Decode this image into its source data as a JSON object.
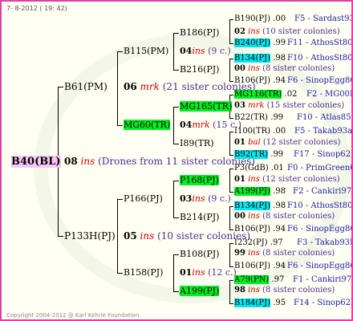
{
  "header": {
    "date": "7- 8-2012 ( 19: 42)"
  },
  "footer": {
    "copyright": "Copyright 2004-2012 @ Karl Kehrle Foundation."
  },
  "root": {
    "label": "B40(BL)",
    "num": "08",
    "mark": "ins",
    "note": "(Drones from 11 sister colonies)"
  },
  "gen1": [
    {
      "label": "B61(PM)",
      "num": "06",
      "mark": "mrk",
      "note": "(21 sister colonies)"
    },
    {
      "label": "P133H(PJ)",
      "num": "05",
      "mark": "ins",
      "note": "(10 sister colonies)"
    }
  ],
  "gen2": [
    {
      "label": "B115(PM)",
      "num": "04",
      "mark": "ins",
      "note": "(9 c.)"
    },
    {
      "label": "MG60(TR)",
      "num": "04",
      "mark": "mrk",
      "note": "(15 c.)"
    },
    {
      "label": "P166(PJ)",
      "num": "03",
      "mark": "ins",
      "note": "(9 c.)"
    },
    {
      "label": "B158(PJ)",
      "num": "01",
      "mark": "ins",
      "note": "(12 c.)"
    }
  ],
  "gen3": [
    {
      "label": "B186(PJ)",
      "num": "02",
      "mark": "ins",
      "note": "(10 sister colonies)"
    },
    {
      "label": "B216(PJ)",
      "num": "00",
      "mark": "ins",
      "note": "(8 sister colonies)"
    },
    {
      "label": "MG165(TR)",
      "num": "03",
      "mark": "mrk",
      "note": "(15 sister colonies)"
    },
    {
      "label": "I89(TR)",
      "num": "01",
      "mark": "bal",
      "note": "(12 sister colonies)"
    },
    {
      "label": "P168(PJ)",
      "num": "01",
      "mark": "ins",
      "note": "(12 sister colonies)"
    },
    {
      "label": "B214(PJ)",
      "num": "00",
      "mark": "ins",
      "note": "(8 sister colonies)"
    },
    {
      "label": "B108(PJ)",
      "num": "99",
      "mark": "ins",
      "note": "(8 sister colonies)"
    },
    {
      "label": "A199(PJ)",
      "num": "98",
      "mark": "ins",
      "note": "(8 sister colonies)"
    }
  ],
  "gen4": [
    {
      "label": "B190(PJ)",
      "year": ".00",
      "origin": "F5 - Sardast93R"
    },
    {
      "label": "B240(PJ)",
      "year": ".99",
      "origin": "F11 - AthosSt80R"
    },
    {
      "label": "B134(PJ)",
      "year": ".98",
      "origin": "F10 - AthosSt80R"
    },
    {
      "label": "B106(PJ)",
      "year": ".94",
      "origin": "F6 - SinopEgg86R"
    },
    {
      "label": "MG116(TR)",
      "year": ".02",
      "origin": "F2 - MG00R"
    },
    {
      "label": "B22(TR)",
      "year": ".99",
      "origin": "F10 - Atlas85R"
    },
    {
      "label": "I100(TR)",
      "year": ".00",
      "origin": "F5 - Takab93aR"
    },
    {
      "label": "B92(TR)",
      "year": ".99",
      "origin": "F17 - Sinop62R"
    },
    {
      "label": "P3(GdB)",
      "year": ".01",
      "origin": "F0 - PrimGreen00"
    },
    {
      "label": "A199(PJ)",
      "year": ".98",
      "origin": "F2 - Cankiri97Q"
    },
    {
      "label": "B134(PJ)",
      "year": ".98",
      "origin": "F10 - AthosSt80R"
    },
    {
      "label": "B106(PJ)",
      "year": ".94",
      "origin": "F6 - SinopEgg86R"
    },
    {
      "label": "I232(PJ)",
      "year": ".97",
      "origin": "F3 - Takab93R"
    },
    {
      "label": "B106(PJ)",
      "year": ".94",
      "origin": "F6 - SinopEgg86R"
    },
    {
      "label": "A79(PN)",
      "year": ".97",
      "origin": "F1 - Cankiri97Q"
    },
    {
      "label": "B184(PJ)",
      "year": ".95",
      "origin": "F14 - Sinop62R"
    }
  ]
}
